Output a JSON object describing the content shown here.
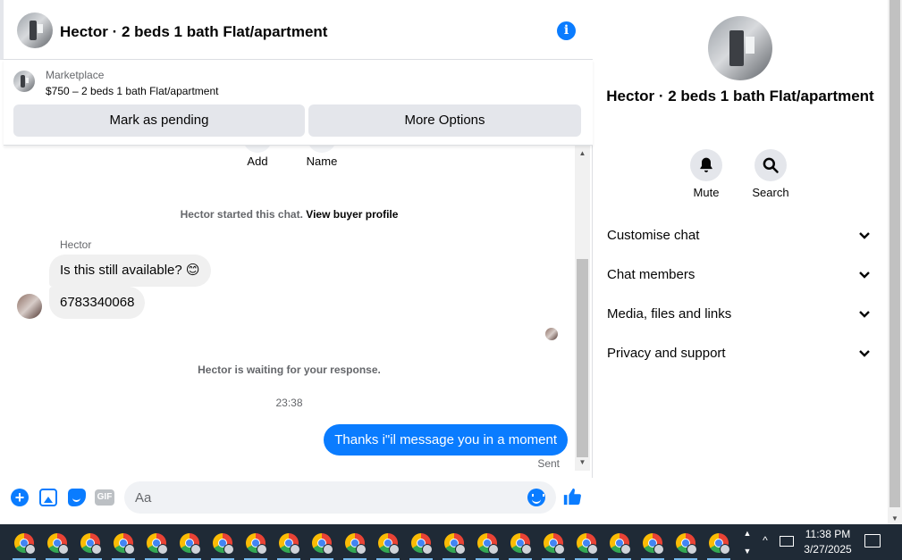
{
  "header": {
    "title": "Hector · 2 beds 1 bath Flat/apartment",
    "info_glyph": "i"
  },
  "marketplace": {
    "label": "Marketplace",
    "listing": "$750 – 2 beds 1 bath Flat/apartment",
    "mark_pending": "Mark as pending",
    "more_options": "More Options"
  },
  "messages": {
    "add_label": "Add",
    "name_label": "Name",
    "started_text": "Hector started this chat.",
    "view_profile": "View buyer profile",
    "sender_name": "Hector",
    "incoming": [
      "Is this still available? 😊",
      "6783340068"
    ],
    "waiting_text": "Hector is waiting for your response.",
    "time": "23:38",
    "outgoing": "Thanks i\"il message you in a moment",
    "sent_status": "Sent"
  },
  "composer": {
    "placeholder": "Aa",
    "gif_label": "GIF",
    "plus_glyph": "+"
  },
  "panel": {
    "title": "Hector · 2 beds 1 bath Flat/apartment",
    "mute_label": "Mute",
    "search_label": "Search",
    "sections": [
      "Customise chat",
      "Chat members",
      "Media, files and links",
      "Privacy and support"
    ]
  },
  "taskbar": {
    "app_count": 22,
    "time": "11:38 PM",
    "date": "3/27/2025"
  },
  "colors": {
    "accent": "#0a7cff",
    "bubble_in": "#f0f0f0",
    "taskbar": "#1f2a36"
  }
}
